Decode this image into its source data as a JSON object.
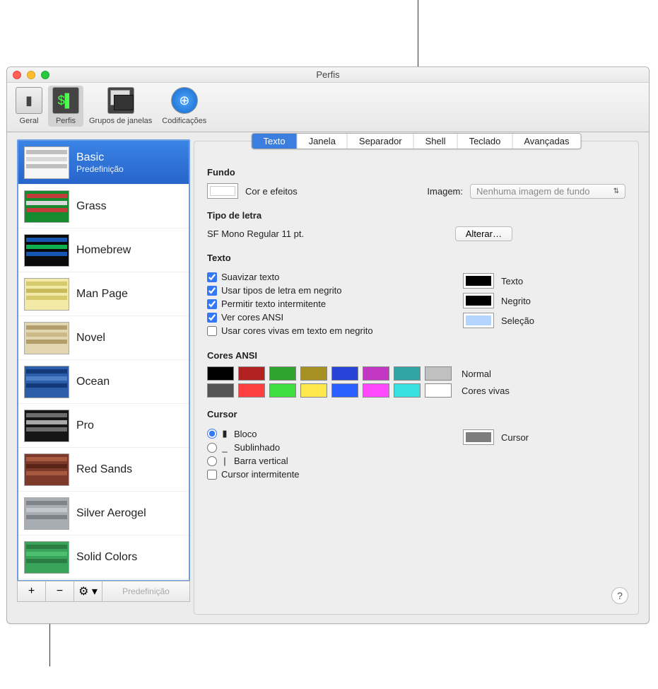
{
  "window": {
    "title": "Perfis"
  },
  "toolbar": {
    "geral": "Geral",
    "perfis": "Perfis",
    "grupos": "Grupos de janelas",
    "codificacoes": "Codificações"
  },
  "profiles": [
    {
      "name": "Basic",
      "sub": "Predefinição",
      "colors": {
        "bg": "#f6f6f6",
        "b1": "#bfbfbf",
        "b2": "#d9d9d9"
      }
    },
    {
      "name": "Grass",
      "colors": {
        "bg": "#168a2e",
        "b1": "#c33c3c",
        "b2": "#d9d9d9"
      }
    },
    {
      "name": "Homebrew",
      "colors": {
        "bg": "#0a0a0a",
        "b1": "#1556b3",
        "b2": "#0eb050"
      }
    },
    {
      "name": "Man Page",
      "colors": {
        "bg": "#f3e9a7",
        "b1": "#d6c96e",
        "b2": "#c9bb5b"
      }
    },
    {
      "name": "Novel",
      "colors": {
        "bg": "#e2d6b0",
        "b1": "#b39d6b",
        "b2": "#cbb98a"
      }
    },
    {
      "name": "Ocean",
      "colors": {
        "bg": "#2b5da8",
        "b1": "#123a78",
        "b2": "#4b7fc6"
      }
    },
    {
      "name": "Pro",
      "colors": {
        "bg": "#161616",
        "b1": "#6d6d6d",
        "b2": "#a8a8a8"
      }
    },
    {
      "name": "Red Sands",
      "colors": {
        "bg": "#7d3a2a",
        "b1": "#a85a40",
        "b2": "#5a2517"
      }
    },
    {
      "name": "Silver Aerogel",
      "colors": {
        "bg": "#a8adb4",
        "b1": "#7f848b",
        "b2": "#c4c8ce"
      }
    },
    {
      "name": "Solid Colors",
      "colors": {
        "bg": "#3aa35a",
        "b1": "#2c7d44",
        "b2": "#4cc06e"
      }
    }
  ],
  "sidebarActions": {
    "add": "+",
    "remove": "−",
    "gear": "⚙︎ ▾",
    "default": "Predefinição"
  },
  "tabs": [
    "Texto",
    "Janela",
    "Separador",
    "Shell",
    "Teclado",
    "Avançadas"
  ],
  "fundo": {
    "heading": "Fundo",
    "cor_efeitos": "Cor e efeitos",
    "imagem_label": "Imagem:",
    "imagem_value": "Nenhuma imagem de fundo"
  },
  "tipo_letra": {
    "heading": "Tipo de letra",
    "value": "SF Mono Regular 11 pt.",
    "alterar": "Alterar…"
  },
  "texto": {
    "heading": "Texto",
    "c1": "Suavizar texto",
    "c2": "Usar tipos de letra em negrito",
    "c3": "Permitir texto intermitente",
    "c4": "Ver cores ANSI",
    "c5": "Usar cores vivas em texto em negrito",
    "texto_label": "Texto",
    "negrito_label": "Negrito",
    "selecao_label": "Seleção"
  },
  "ansi": {
    "heading": "Cores ANSI",
    "normal_label": "Normal",
    "vivas_label": "Cores vivas",
    "normal": [
      "#000000",
      "#b22222",
      "#2fa52f",
      "#a69122",
      "#2742d6",
      "#c238c2",
      "#2fa5a5",
      "#c0c0c0"
    ],
    "vivas": [
      "#555555",
      "#ff4040",
      "#40de40",
      "#ffe84d",
      "#2a60ff",
      "#ff49ff",
      "#39e0e0",
      "#ffffff"
    ]
  },
  "cursor": {
    "heading": "Cursor",
    "bloco": "Bloco",
    "sublinhado": "Sublinhado",
    "barra": "Barra vertical",
    "intermitente": "Cursor intermitente",
    "label": "Cursor",
    "color": "#7d7d7d"
  },
  "chart_data": null
}
